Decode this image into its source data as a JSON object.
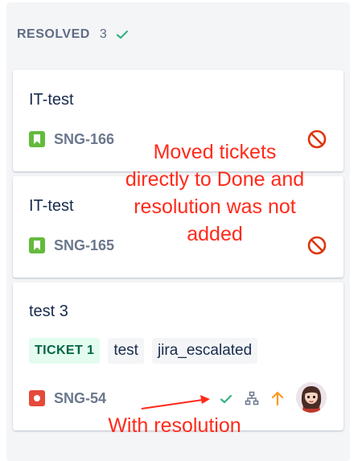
{
  "column": {
    "title": "RESOLVED",
    "count": "3"
  },
  "cards": [
    {
      "title": "IT-test",
      "key": "SNG-166",
      "type": "story"
    },
    {
      "title": "IT-test",
      "key": "SNG-165",
      "type": "story"
    },
    {
      "title": "test 3",
      "key": "SNG-54",
      "type": "bug",
      "epic": "TICKET 1",
      "labels": [
        "test",
        "jira_escalated"
      ],
      "priority": "arrow-up-icon",
      "resolution": "check-icon"
    }
  ],
  "annotations": {
    "no_resolution_line1": "Moved tickets",
    "no_resolution_line2": "directly to Done and",
    "no_resolution_line3": "resolution was not",
    "no_resolution_line4": "added",
    "with_resolution": "With resolution"
  },
  "colors": {
    "annotation": "#ff2a1a",
    "done_green": "#36b37e",
    "blocker_red": "#de350b",
    "priority_orange": "#ff991f"
  }
}
